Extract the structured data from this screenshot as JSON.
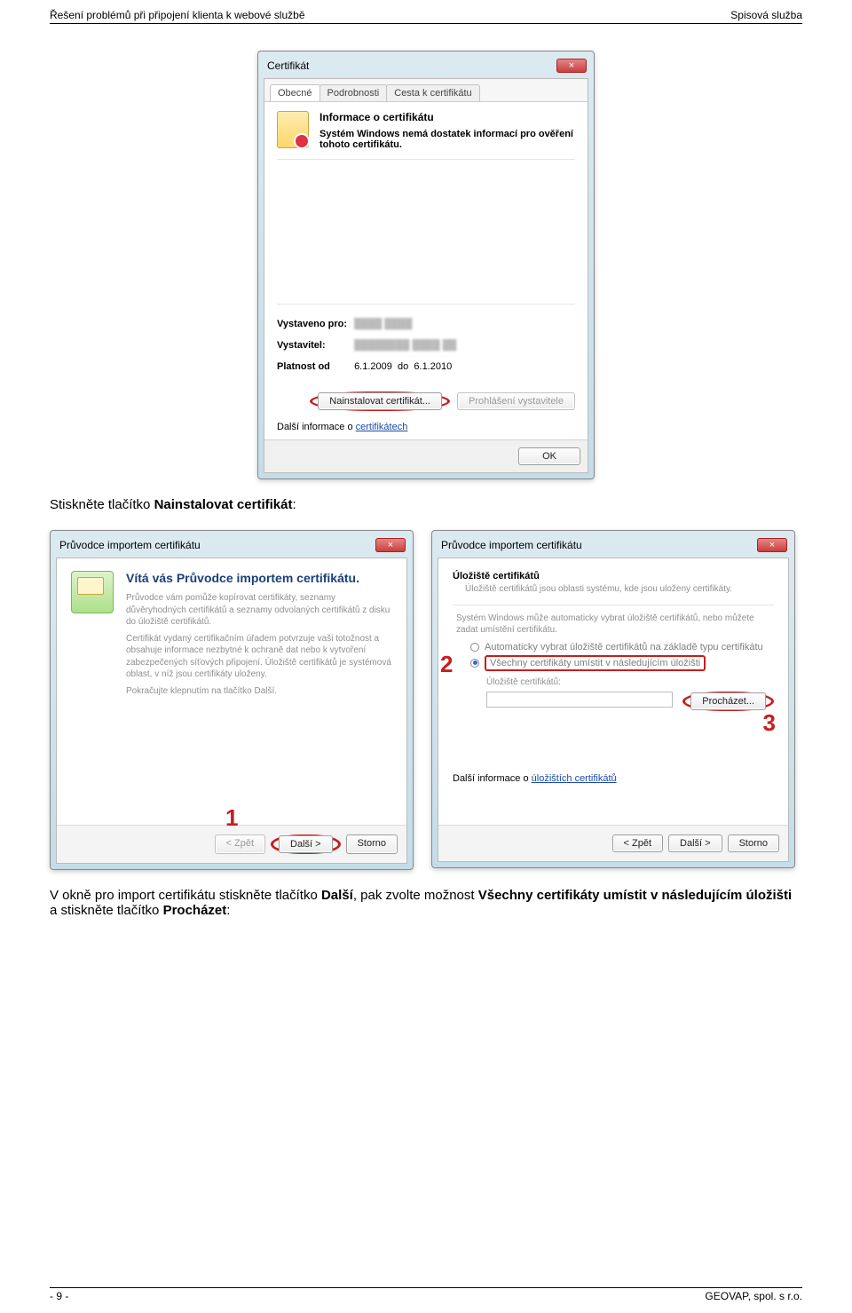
{
  "header": {
    "left": "Řešení problémů při připojení klienta k webové službě",
    "right": "Spisová služba"
  },
  "footer": {
    "page": "- 9 -",
    "company": "GEOVAP, spol. s r.o."
  },
  "para1_a": "Stiskněte tlačítko ",
  "para1_b": "Nainstalovat certifikát",
  "para1_c": ":",
  "para2_a": "V okně pro import certifikátu stiskněte tlačítko ",
  "para2_b": "Další",
  "para2_c": ", pak zvolte možnost ",
  "para2_d": "Všechny certifikáty umístit v následujícím úložišti",
  "para2_e": " a stiskněte tlačítko ",
  "para2_f": "Procházet",
  "para2_g": ":",
  "cert": {
    "title": "Certifikát",
    "tabs": {
      "t1": "Obecné",
      "t2": "Podrobnosti",
      "t3": "Cesta k certifikátu"
    },
    "heading": "Informace o certifikátu",
    "msg": "Systém Windows nemá dostatek informací pro ověření tohoto certifikátu.",
    "issued_to_label": "Vystaveno pro:",
    "issued_by_label": "Vystavitel:",
    "valid_label": "Platnost od",
    "valid_from": "6.1.2009",
    "valid_to_label": "do",
    "valid_to": "6.1.2010",
    "install_btn": "Nainstalovat certifikát...",
    "issuer_stmt": "Prohlášení vystavitele",
    "more_info": "Další informace o ",
    "more_link": "certifikátech",
    "ok": "OK"
  },
  "wiz1": {
    "title": "Průvodce importem certifikátu",
    "heading": "Vítá vás Průvodce importem certifikátu.",
    "p1": "Průvodce vám pomůže kopírovat certifikáty, seznamy důvěryhodných certifikátů a seznamy odvolaných certifikátů z disku do úložiště certifikátů.",
    "p2": "Certifikát vydaný certifikačním úřadem potvrzuje vaši totožnost a obsahuje informace nezbytné k ochraně dat nebo k vytvoření zabezpečených síťových připojení. Úložiště certifikátů je systémová oblast, v níž jsou certifikáty uloženy.",
    "p3": "Pokračujte klepnutím na tlačítko Další.",
    "back": "< Zpět",
    "next": "Další >",
    "cancel": "Storno",
    "digit": "1"
  },
  "wiz2": {
    "title": "Průvodce importem certifikátu",
    "heading": "Úložiště certifikátů",
    "sub": "Úložiště certifikátů jsou oblasti systému, kde jsou uloženy certifikáty.",
    "auto": "Systém Windows může automaticky vybrat úložiště certifikátů, nebo můžete zadat umístění certifikátu.",
    "opt1": "Automaticky vybrat úložiště certifikátů na základě typu certifikátu",
    "opt2": "Všechny certifikáty umístit v následujícím úložišti",
    "store_label": "Úložiště certifikátů:",
    "browse": "Procházet...",
    "more_a": "Další informace o ",
    "more_b": "úložištích certifikátů",
    "back": "< Zpět",
    "next": "Další >",
    "cancel": "Storno",
    "digit2": "2",
    "digit3": "3"
  }
}
